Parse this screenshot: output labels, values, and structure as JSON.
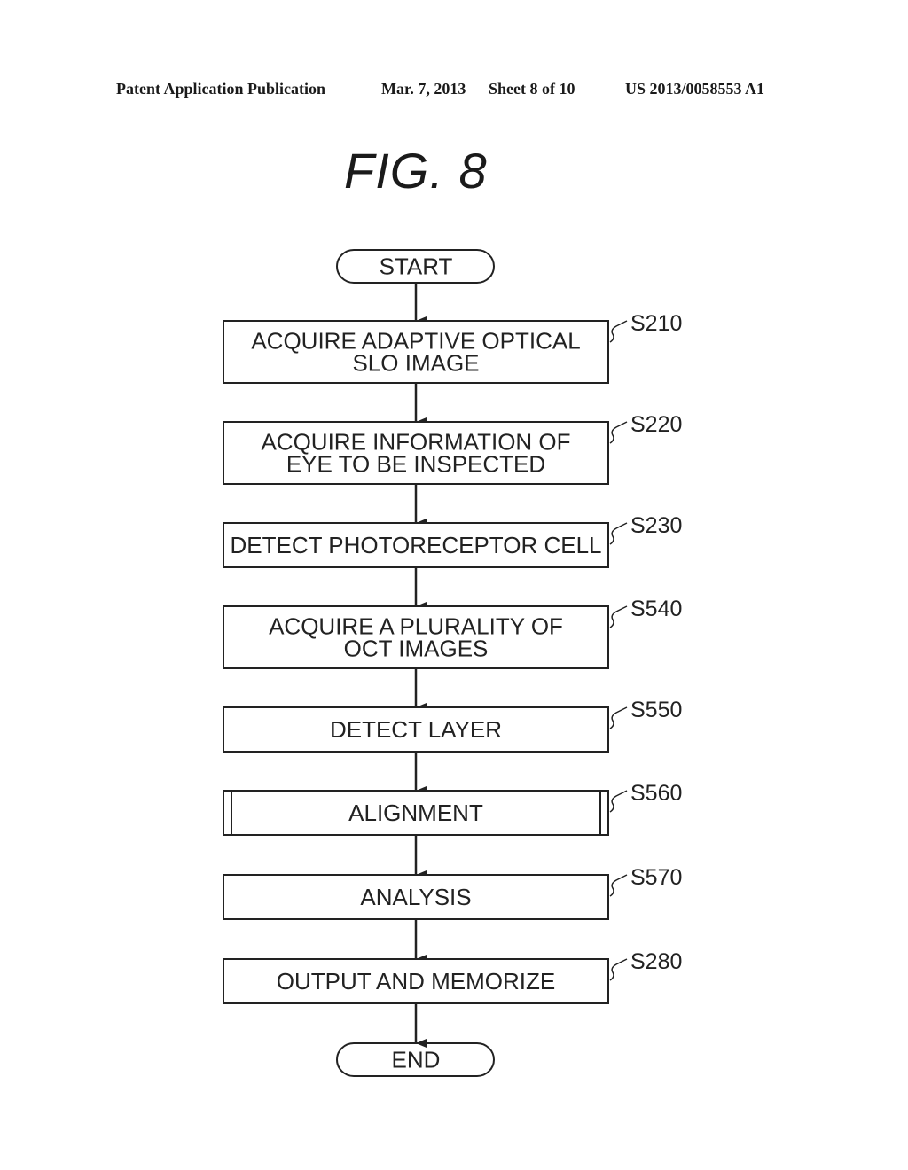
{
  "header": {
    "publication": "Patent Application Publication",
    "date": "Mar. 7, 2013",
    "sheet": "Sheet 8 of 10",
    "number": "US 2013/0058553 A1"
  },
  "figure": {
    "title": "FIG.  8"
  },
  "flow": {
    "start": "START",
    "end": "END",
    "steps": [
      {
        "id": "S210",
        "lines": [
          "ACQUIRE ADAPTIVE OPTICAL",
          "SLO IMAGE"
        ],
        "type": "process"
      },
      {
        "id": "S220",
        "lines": [
          "ACQUIRE INFORMATION OF",
          "EYE TO BE INSPECTED"
        ],
        "type": "process"
      },
      {
        "id": "S230",
        "lines": [
          "DETECT PHOTORECEPTOR CELL"
        ],
        "type": "process"
      },
      {
        "id": "S540",
        "lines": [
          "ACQUIRE A PLURALITY OF",
          "OCT IMAGES"
        ],
        "type": "process"
      },
      {
        "id": "S550",
        "lines": [
          "DETECT LAYER"
        ],
        "type": "process"
      },
      {
        "id": "S560",
        "lines": [
          "ALIGNMENT"
        ],
        "type": "subroutine"
      },
      {
        "id": "S570",
        "lines": [
          "ANALYSIS"
        ],
        "type": "process"
      },
      {
        "id": "S280",
        "lines": [
          "OUTPUT AND MEMORIZE"
        ],
        "type": "process"
      }
    ]
  }
}
